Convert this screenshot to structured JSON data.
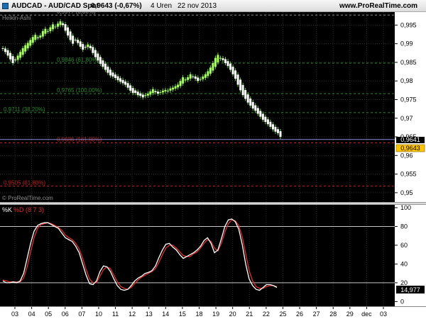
{
  "window": {
    "symbol": "AUDCAD - AUD/CAD Spot",
    "last": "0,9643 (-0,67%)",
    "period": "4 Uren",
    "date": "22 nov 2013",
    "watermark": "www.ProRealTime.com"
  },
  "price_panel": {
    "indicator_label": "Heikin-Ashi",
    "copyright": "© ProRealTime.com",
    "current_price_label": "0,9643",
    "upper_box_label": "0,9641"
  },
  "osc_panel": {
    "k_label": "%K",
    "d_label": "%D (8 7 3)",
    "current_value_label": "14,977"
  },
  "chart_data": [
    {
      "type": "candlestick",
      "style": "Heikin-Ashi",
      "x_tick_labels": [
        "03",
        "04",
        "05",
        "06",
        "07",
        "10",
        "11",
        "12",
        "13",
        "14",
        "15",
        "18",
        "19",
        "20",
        "21",
        "22",
        "25",
        "26",
        "27",
        "28",
        "29",
        "dec",
        "03"
      ],
      "y_tick_labels": [
        "0,995",
        "0,99",
        "0,985",
        "0,98",
        "0,975",
        "0,97",
        "0,965",
        "0,96",
        "0,955",
        "0,95"
      ],
      "ylim": [
        0.9475,
        0.9985
      ],
      "grid": true,
      "fibonacci_levels": [
        {
          "label": "0,9977 (0,00%)",
          "value": 0.9977,
          "color": "#8c8c8c"
        },
        {
          "label": "0,9846 (61,80%)",
          "value": 0.9848,
          "color": "#2c8a2c"
        },
        {
          "label": "0,9765 (100,00%)",
          "value": 0.9766,
          "color": "#2c8a2c"
        },
        {
          "label": "0,9711 (38,20%)",
          "value": 0.9715,
          "color": "#2c8a2c"
        },
        {
          "label": "0,9636 (161,80%)",
          "value": 0.9634,
          "color": "#c42020"
        },
        {
          "label": "0,9505 (61,80%)",
          "value": 0.9518,
          "color": "#c42020"
        }
      ],
      "current_price": 0.9643,
      "colors": {
        "bull": "#a8ff60",
        "bear": "#ffffff",
        "wick": "#6fd24a"
      },
      "closes": [
        0.9886,
        0.9878,
        0.9868,
        0.9858,
        0.9848,
        0.9856,
        0.9868,
        0.9878,
        0.9888,
        0.9896,
        0.9902,
        0.991,
        0.9918,
        0.9924,
        0.9916,
        0.9922,
        0.9934,
        0.994,
        0.9934,
        0.9944,
        0.9952,
        0.9946,
        0.9954,
        0.996,
        0.995,
        0.9935,
        0.9922,
        0.991,
        0.99,
        0.991,
        0.9902,
        0.9892,
        0.9884,
        0.989,
        0.9898,
        0.9888,
        0.9875,
        0.9864,
        0.9855,
        0.9846,
        0.9838,
        0.983,
        0.9822,
        0.9815,
        0.9812,
        0.9808,
        0.9802,
        0.9798,
        0.9794,
        0.979,
        0.9782,
        0.9774,
        0.9768,
        0.9768,
        0.9762,
        0.976,
        0.9756,
        0.9762,
        0.9766,
        0.9772,
        0.9778,
        0.977,
        0.9766,
        0.977,
        0.9774,
        0.9776,
        0.9774,
        0.978,
        0.9782,
        0.9786,
        0.979,
        0.98,
        0.981,
        0.9804,
        0.981,
        0.9818,
        0.9812,
        0.9806,
        0.98,
        0.9805,
        0.9812,
        0.9818,
        0.9826,
        0.9836,
        0.9848,
        0.9862,
        0.987,
        0.9862,
        0.9856,
        0.9848,
        0.984,
        0.983,
        0.9818,
        0.9806,
        0.979,
        0.9775,
        0.9762,
        0.9752,
        0.9742,
        0.9734,
        0.9726,
        0.972,
        0.9712,
        0.9704,
        0.9696,
        0.969,
        0.9684,
        0.9677,
        0.967,
        0.9664,
        0.966,
        0.965
      ]
    },
    {
      "type": "line",
      "title": "%K %D (8 7 3)",
      "y_tick_labels": [
        "100",
        "80",
        "60",
        "40",
        "20",
        "0"
      ],
      "ylim": [
        -5,
        103
      ],
      "reference_lines": [
        80,
        20
      ],
      "current_value": 14.977,
      "series": [
        {
          "name": "%K",
          "color": "#ffffff",
          "values": [
            22,
            20,
            20,
            21,
            20,
            22,
            30,
            46,
            62,
            75,
            81,
            83,
            84,
            84,
            82,
            80,
            78,
            73,
            68,
            66,
            64,
            59,
            52,
            40,
            28,
            19,
            18,
            22,
            32,
            38,
            37,
            32,
            24,
            17,
            13,
            12,
            13,
            17,
            22,
            25,
            27,
            30,
            31,
            33,
            38,
            47,
            55,
            61,
            62,
            58,
            55,
            50,
            46,
            48,
            50,
            52,
            55,
            59,
            65,
            68,
            62,
            52,
            55,
            67,
            80,
            87,
            88,
            85,
            77,
            61,
            40,
            24,
            17,
            13,
            12,
            15,
            18,
            18,
            17,
            15
          ]
        },
        {
          "name": "%D",
          "color": "#e23030",
          "values": [
            23,
            22,
            21,
            21,
            21,
            21,
            25,
            37,
            53,
            68,
            78,
            82,
            83,
            84,
            83,
            81,
            79,
            76,
            71,
            68,
            66,
            62,
            56,
            46,
            34,
            24,
            20,
            20,
            27,
            34,
            37,
            35,
            28,
            21,
            16,
            14,
            13,
            15,
            19,
            23,
            26,
            28,
            30,
            32,
            35,
            42,
            50,
            57,
            60,
            60,
            57,
            53,
            49,
            48,
            48,
            51,
            53,
            57,
            62,
            66,
            64,
            57,
            54,
            62,
            74,
            83,
            87,
            86,
            81,
            69,
            51,
            33,
            22,
            16,
            14,
            14,
            16,
            17,
            17,
            16
          ]
        }
      ]
    }
  ]
}
